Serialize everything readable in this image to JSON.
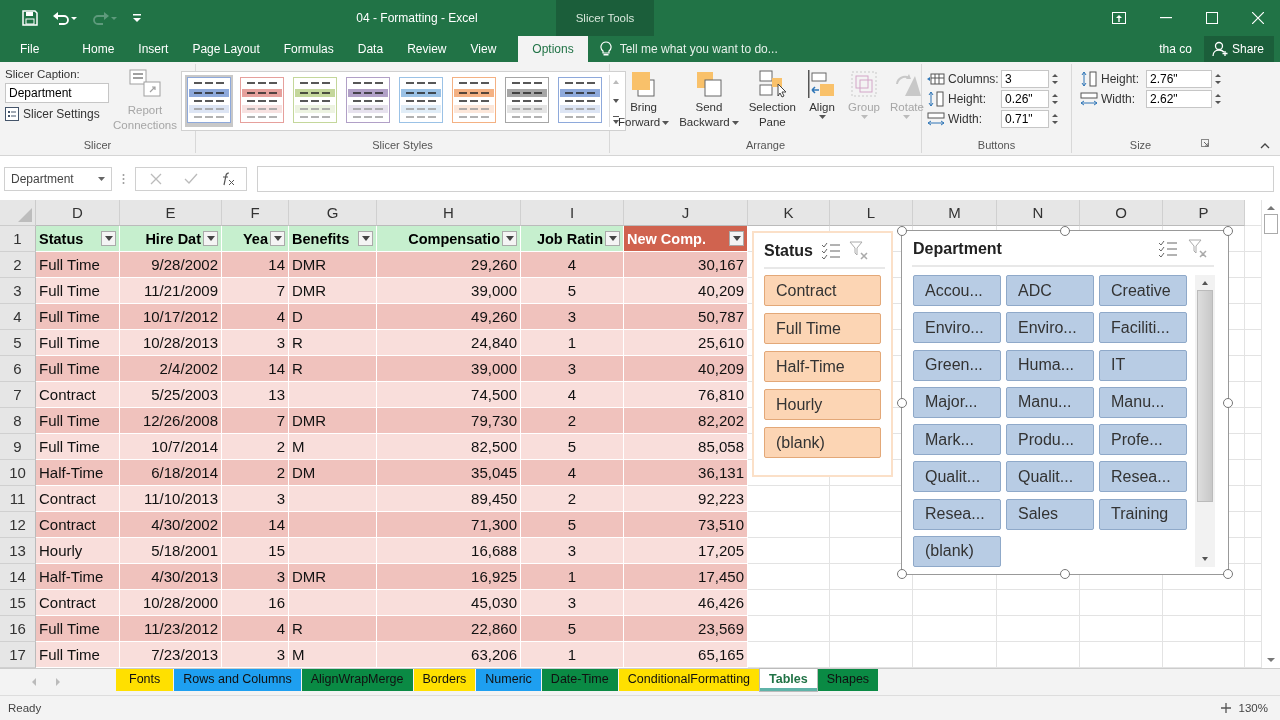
{
  "window": {
    "title": "04 - Formatting - Excel",
    "context_tab": "Slicer Tools",
    "account": "tha co",
    "share": "Share"
  },
  "ribbon_tabs": [
    {
      "label": "File",
      "selected": false
    },
    {
      "label": "Home",
      "selected": false
    },
    {
      "label": "Insert",
      "selected": false
    },
    {
      "label": "Page Layout",
      "selected": false
    },
    {
      "label": "Formulas",
      "selected": false
    },
    {
      "label": "Data",
      "selected": false
    },
    {
      "label": "Review",
      "selected": false
    },
    {
      "label": "View",
      "selected": false
    },
    {
      "label": "Options",
      "selected": true
    }
  ],
  "tell_me": {
    "placeholder": "Tell me what you want to do..."
  },
  "ribbon": {
    "slicer": {
      "caption_label": "Slicer Caption:",
      "caption_value": "Department",
      "settings": "Slicer Settings",
      "report_connections": {
        "label": "Report Connections",
        "disabled": true
      },
      "label": "Slicer"
    },
    "slicer_styles": {
      "label": "Slicer Styles",
      "styles": [
        {
          "color": "#8ea9db",
          "selected": true
        },
        {
          "color": "#e6a09c",
          "selected": false
        },
        {
          "color": "#c4d79b",
          "selected": false
        },
        {
          "color": "#b1a0c7",
          "selected": false
        },
        {
          "color": "#9bc2e6",
          "selected": false
        },
        {
          "color": "#f4b183",
          "selected": false
        },
        {
          "color": "#a6a6a6",
          "selected": false
        },
        {
          "color": "#8ea9db",
          "selected": false
        }
      ]
    },
    "arrange": {
      "label": "Arrange",
      "buttons": [
        {
          "kind": "forward",
          "line1": "Bring",
          "line2": "Forward",
          "dropdown": true,
          "disabled": false
        },
        {
          "kind": "backward",
          "line1": "Send",
          "line2": "Backward",
          "dropdown": true,
          "disabled": false
        },
        {
          "kind": "pane",
          "line1": "Selection",
          "line2": "Pane",
          "dropdown": false,
          "disabled": false
        },
        {
          "kind": "align",
          "line1": "Align",
          "dropdown": true,
          "disabled": false
        },
        {
          "kind": "group",
          "line1": "Group",
          "dropdown": true,
          "disabled": true
        },
        {
          "kind": "rotate",
          "line1": "Rotate",
          "dropdown": true,
          "disabled": true
        }
      ]
    },
    "buttons": {
      "label": "Buttons",
      "fields": [
        {
          "kind": "columns",
          "label": "Columns:",
          "value": "3"
        },
        {
          "kind": "height",
          "label": "Height:",
          "value": "0.26\""
        },
        {
          "kind": "width",
          "label": "Width:",
          "value": "0.71\""
        }
      ]
    },
    "size": {
      "label": "Size",
      "fields": [
        {
          "kind": "height",
          "label": "Height:",
          "value": "2.76\""
        },
        {
          "kind": "width",
          "label": "Width:",
          "value": "2.62\""
        }
      ]
    }
  },
  "formula_bar": {
    "name_box": "Department"
  },
  "sheet": {
    "column_letters": [
      "D",
      "E",
      "F",
      "G",
      "H",
      "I",
      "J",
      "K",
      "L",
      "M",
      "N",
      "O",
      "P"
    ],
    "header_row": "1",
    "headers": [
      {
        "label": "Status",
        "highlighted": false
      },
      {
        "label": "Hire Dat",
        "highlighted": false
      },
      {
        "label": "Yea",
        "highlighted": false
      },
      {
        "label": "Benefits",
        "highlighted": false
      },
      {
        "label": "Compensatio",
        "highlighted": false
      },
      {
        "label": "Job Ratin",
        "highlighted": false
      },
      {
        "label": "New Comp.",
        "highlighted": true
      }
    ],
    "rows": [
      {
        "number": "2",
        "cells": [
          "Full Time",
          "9/28/2002",
          "14",
          "DMR",
          "29,260",
          "4",
          "30,167"
        ]
      },
      {
        "number": "3",
        "cells": [
          "Full Time",
          "11/21/2009",
          "7",
          "DMR",
          "39,000",
          "5",
          "40,209"
        ]
      },
      {
        "number": "4",
        "cells": [
          "Full Time",
          "10/17/2012",
          "4",
          "D",
          "49,260",
          "3",
          "50,787"
        ]
      },
      {
        "number": "5",
        "cells": [
          "Full Time",
          "10/28/2013",
          "3",
          "R",
          "24,840",
          "1",
          "25,610"
        ]
      },
      {
        "number": "6",
        "cells": [
          "Full Time",
          "2/4/2002",
          "14",
          "R",
          "39,000",
          "3",
          "40,209"
        ]
      },
      {
        "number": "7",
        "cells": [
          "Contract",
          "5/25/2003",
          "13",
          null,
          "74,500",
          "4",
          "76,810"
        ]
      },
      {
        "number": "8",
        "cells": [
          "Full Time",
          "12/26/2008",
          "7",
          "DMR",
          "79,730",
          "2",
          "82,202"
        ]
      },
      {
        "number": "9",
        "cells": [
          "Full Time",
          "10/7/2014",
          "2",
          "M",
          "82,500",
          "5",
          "85,058"
        ]
      },
      {
        "number": "10",
        "cells": [
          "Half-Time",
          "6/18/2014",
          "2",
          "DM",
          "35,045",
          "4",
          "36,131"
        ]
      },
      {
        "number": "11",
        "cells": [
          "Contract",
          "11/10/2013",
          "3",
          null,
          "89,450",
          "2",
          "92,223"
        ]
      },
      {
        "number": "12",
        "cells": [
          "Contract",
          "4/30/2002",
          "14",
          null,
          "71,300",
          "5",
          "73,510"
        ]
      },
      {
        "number": "13",
        "cells": [
          "Hourly",
          "5/18/2001",
          "15",
          null,
          "16,688",
          "3",
          "17,205"
        ]
      },
      {
        "number": "14",
        "cells": [
          "Half-Time",
          "4/30/2013",
          "3",
          "DMR",
          "16,925",
          "1",
          "17,450"
        ]
      },
      {
        "number": "15",
        "cells": [
          "Contract",
          "10/28/2000",
          "16",
          null,
          "45,030",
          "3",
          "46,426"
        ]
      },
      {
        "number": "16",
        "cells": [
          "Full Time",
          "11/23/2012",
          "4",
          "R",
          "22,860",
          "5",
          "23,569"
        ]
      },
      {
        "number": "17",
        "cells": [
          "Full Time",
          "7/23/2013",
          "3",
          "M",
          "63,206",
          "1",
          "65,165"
        ]
      }
    ]
  },
  "status_slicer": {
    "title": "Status",
    "selected": false,
    "items": [
      {
        "label": "Contract",
        "selected": true
      },
      {
        "label": "Full Time",
        "selected": true
      },
      {
        "label": "Half-Time",
        "selected": true
      },
      {
        "label": "Hourly",
        "selected": true
      },
      {
        "label": "(blank)",
        "selected": true
      }
    ]
  },
  "department_slicer": {
    "title": "Department",
    "selected": true,
    "items": [
      {
        "label": "Accou...",
        "selected": true
      },
      {
        "label": "ADC",
        "selected": true
      },
      {
        "label": "Creative",
        "selected": true
      },
      {
        "label": "Enviro...",
        "selected": true
      },
      {
        "label": "Enviro...",
        "selected": true
      },
      {
        "label": "Faciliti...",
        "selected": true
      },
      {
        "label": "Green...",
        "selected": true
      },
      {
        "label": "Huma...",
        "selected": true
      },
      {
        "label": "IT",
        "selected": true
      },
      {
        "label": "Major...",
        "selected": true
      },
      {
        "label": "Manu...",
        "selected": true
      },
      {
        "label": "Manu...",
        "selected": true
      },
      {
        "label": "Mark...",
        "selected": true
      },
      {
        "label": "Produ...",
        "selected": true
      },
      {
        "label": "Profe...",
        "selected": true
      },
      {
        "label": "Qualit...",
        "selected": true
      },
      {
        "label": "Qualit...",
        "selected": true
      },
      {
        "label": "Resea...",
        "selected": true
      },
      {
        "label": "Resea...",
        "selected": true
      },
      {
        "label": "Sales",
        "selected": true
      },
      {
        "label": "Training",
        "selected": true
      },
      {
        "label": "(blank)",
        "selected": true
      }
    ]
  },
  "sheet_tabs": [
    {
      "label": "Fonts",
      "color": "#ffe000",
      "selected": false
    },
    {
      "label": "Rows and Columns",
      "color": "#1e9ff0",
      "selected": false
    },
    {
      "label": "AlignWrapMerge",
      "color": "#0a8a44",
      "selected": false
    },
    {
      "label": "Borders",
      "color": "#ffe000",
      "selected": false
    },
    {
      "label": "Numeric",
      "color": "#1e9ff0",
      "selected": false
    },
    {
      "label": "Date-Time",
      "color": "#0a8a44",
      "selected": false
    },
    {
      "label": "ConditionalFormatting",
      "color": "#ffe000",
      "selected": false
    },
    {
      "label": "Tables",
      "color": "#5fb3a8",
      "selected": true
    },
    {
      "label": "Shapes",
      "color": "#0a8a44",
      "selected": false
    }
  ],
  "status_bar": {
    "text": "Ready",
    "zoom": "130%"
  }
}
